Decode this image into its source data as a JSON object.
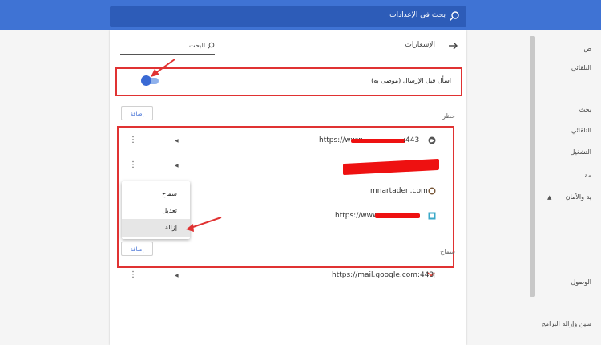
{
  "search": {
    "placeholder": "بحث في الإعدادات"
  },
  "header": {
    "title": "الإشعارات",
    "filter_label": "البحث"
  },
  "toggle": {
    "label": "اسأل قبل الإرسال (موصى به)",
    "on": true
  },
  "block_section": {
    "label": "حظر",
    "add_label": "إضافة"
  },
  "allow_section": {
    "label": "سماح",
    "add_label": "إضافة"
  },
  "sites": [
    {
      "url": "https://www.",
      "suffix": ":443",
      "icon": "globe-icon"
    },
    {
      "url": "",
      "suffix": "",
      "icon": ""
    },
    {
      "url": "mnartaden.com",
      "suffix": "",
      "icon": "site-icon"
    },
    {
      "url": "https://www.",
      "suffix": "",
      "icon": "page-icon"
    }
  ],
  "allowed_site": {
    "url": "https://mail.google.com:443",
    "icon": "gmail-icon"
  },
  "context_menu": {
    "items": [
      "سماح",
      "تعديل",
      "إزالة"
    ]
  },
  "right_nav": {
    "items": [
      "ص",
      "التلقائي",
      "بحث",
      "التلقائي",
      "التشغيل",
      "مة",
      "ية والأمان",
      "الوصول",
      "سين وإزالة البرامج"
    ]
  },
  "colors": {
    "topbar": "#3f73d4",
    "accent": "#3a6ad4",
    "annotation": "#e03232"
  }
}
